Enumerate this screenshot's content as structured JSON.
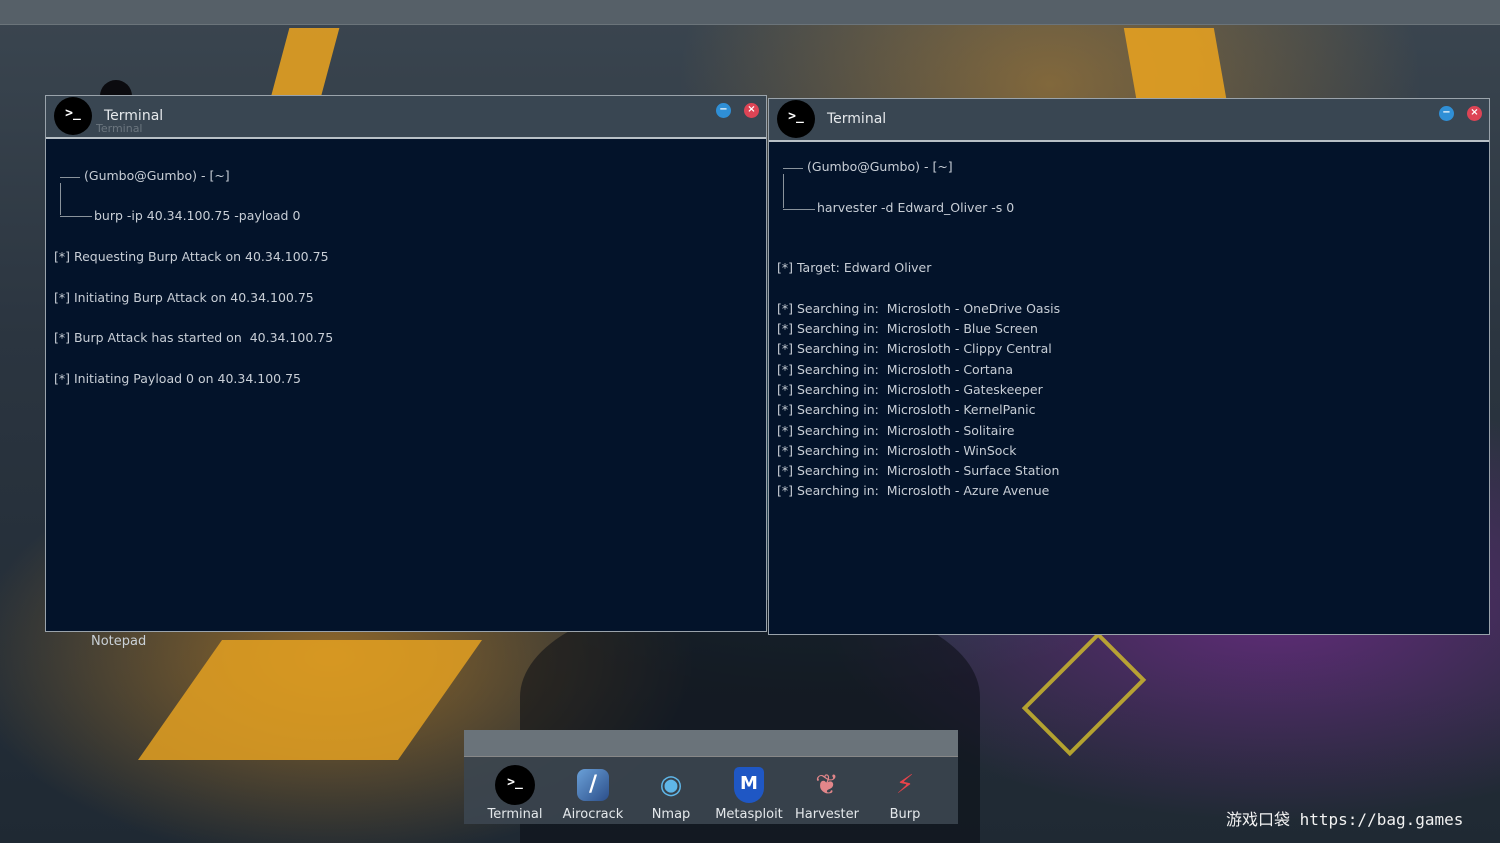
{
  "desktop": {
    "notepad_label": "Notepad"
  },
  "window_left": {
    "icon": ">_",
    "title": "Terminal",
    "ghost_title": "Terminal",
    "prompt": "(Gumbo@Gumbo) - [~]",
    "command": "burp -ip 40.34.100.75 -payload 0",
    "output": [
      "[*] Requesting Burp Attack on 40.34.100.75",
      "[*] Initiating Burp Attack on 40.34.100.75",
      "[*] Burp Attack has started on  40.34.100.75",
      "[*] Initiating Payload 0 on 40.34.100.75"
    ]
  },
  "window_right": {
    "icon": ">_",
    "title": "Terminal",
    "prompt": "(Gumbo@Gumbo) - [~]",
    "command": "harvester -d Edward_Oliver -s 0",
    "target": "[*] Target: Edward Oliver",
    "output": [
      "[*] Searching in:  Microsloth - OneDrive Oasis",
      "[*] Searching in:  Microsloth - Blue Screen",
      "[*] Searching in:  Microsloth - Clippy Central",
      "[*] Searching in:  Microsloth - Cortana",
      "[*] Searching in:  Microsloth - Gateskeeper",
      "[*] Searching in:  Microsloth - KernelPanic",
      "[*] Searching in:  Microsloth - Solitaire",
      "[*] Searching in:  Microsloth - WinSock",
      "[*] Searching in:  Microsloth - Surface Station",
      "[*] Searching in:  Microsloth - Azure Avenue"
    ]
  },
  "dock": {
    "items": [
      {
        "label": "Terminal",
        "icon": "terminal-icon",
        "glyph": ">_"
      },
      {
        "label": "Airocrack",
        "icon": "airocrack-icon",
        "glyph": "/"
      },
      {
        "label": "Nmap",
        "icon": "eye-icon",
        "glyph": "◉"
      },
      {
        "label": "Metasploit",
        "icon": "shield-m-icon",
        "glyph": "M"
      },
      {
        "label": "Harvester",
        "icon": "feather-icon",
        "glyph": "❦"
      },
      {
        "label": "Burp",
        "icon": "burp-lightning-icon",
        "glyph": "⚡"
      }
    ]
  },
  "watermark": "游戏口袋 https://bag.games",
  "colors": {
    "terminal_bg": "#03132a",
    "minimize": "#2f8fd6",
    "close": "#dd4455",
    "accent_yellow": "#e3a021"
  }
}
